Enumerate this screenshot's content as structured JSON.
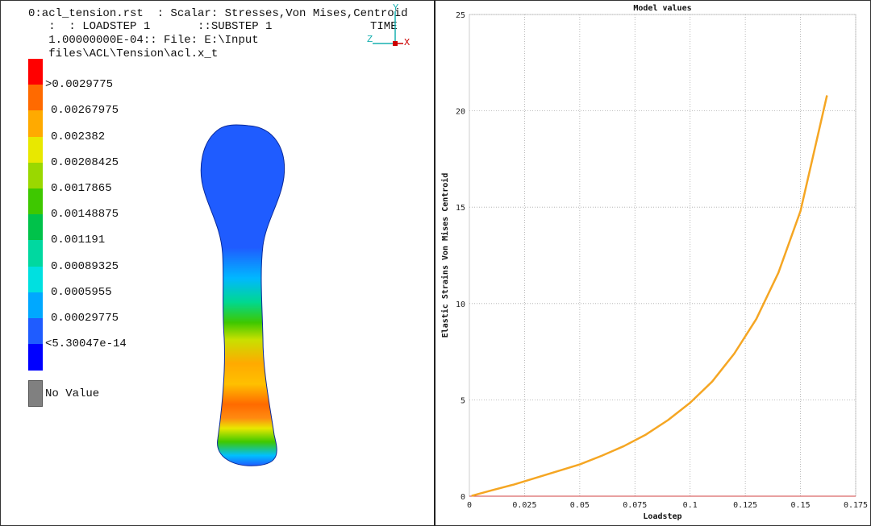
{
  "header": {
    "line1": "0:acl_tension.rst  : Scalar: Stresses,Von Mises,Centroid",
    "line2": "   :  : LOADSTEP 1       ::SUBSTEP 1",
    "line3": "   1.00000000E-04:: File: E:\\Input",
    "line4": "   files\\ACL\\Tension\\acl.x_t",
    "time_label": "TIME"
  },
  "triad": {
    "y": "Y",
    "z": "Z",
    "x": "X",
    "colors": {
      "y": "#18b0b0",
      "z": "#18b0b0",
      "x": "#cc0000"
    }
  },
  "legend": {
    "bands": [
      {
        "color": "#ff0000",
        "label": ">0.0029775"
      },
      {
        "color": "#ff6a00",
        "label": "0.00267975"
      },
      {
        "color": "#ffaa00",
        "label": "0.002382"
      },
      {
        "color": "#e8e800",
        "label": "0.00208425"
      },
      {
        "color": "#9ad800",
        "label": "0.0017865"
      },
      {
        "color": "#3ec800",
        "label": "0.00148875"
      },
      {
        "color": "#00c24a",
        "label": "0.001191"
      },
      {
        "color": "#00d8a0",
        "label": "0.00089325"
      },
      {
        "color": "#00e0e0",
        "label": "0.0005955"
      },
      {
        "color": "#00a8ff",
        "label": "0.00029775"
      },
      {
        "color": "#1f5cff",
        "label": "<5.30047e-14"
      },
      {
        "color": "#0000ff",
        "label": ""
      }
    ],
    "no_value_label": "No Value",
    "no_value_color": "#808080"
  },
  "chart_data": {
    "type": "line",
    "title": "Model values",
    "xlabel": "Loadstep",
    "ylabel": "Elastic Strains Von Mises Centroid",
    "xlim": [
      0,
      0.175
    ],
    "ylim": [
      0,
      25
    ],
    "xticks": [
      "0",
      "0.025",
      "0.05",
      "0.075",
      "0.1",
      "0.125",
      "0.15",
      "0.175"
    ],
    "yticks": [
      "0",
      "5",
      "10",
      "15",
      "20",
      "25"
    ],
    "grid": true,
    "series": [
      {
        "color": "#f5a623",
        "x": [
          0.001,
          0.01,
          0.02,
          0.03,
          0.04,
          0.05,
          0.06,
          0.07,
          0.08,
          0.09,
          0.1,
          0.11,
          0.12,
          0.13,
          0.14,
          0.15,
          0.16,
          0.162
        ],
        "y": [
          0.02,
          0.3,
          0.6,
          0.95,
          1.3,
          1.65,
          2.1,
          2.6,
          3.2,
          3.95,
          4.85,
          5.95,
          7.4,
          9.2,
          11.6,
          14.8,
          19.8,
          20.8
        ]
      }
    ]
  }
}
